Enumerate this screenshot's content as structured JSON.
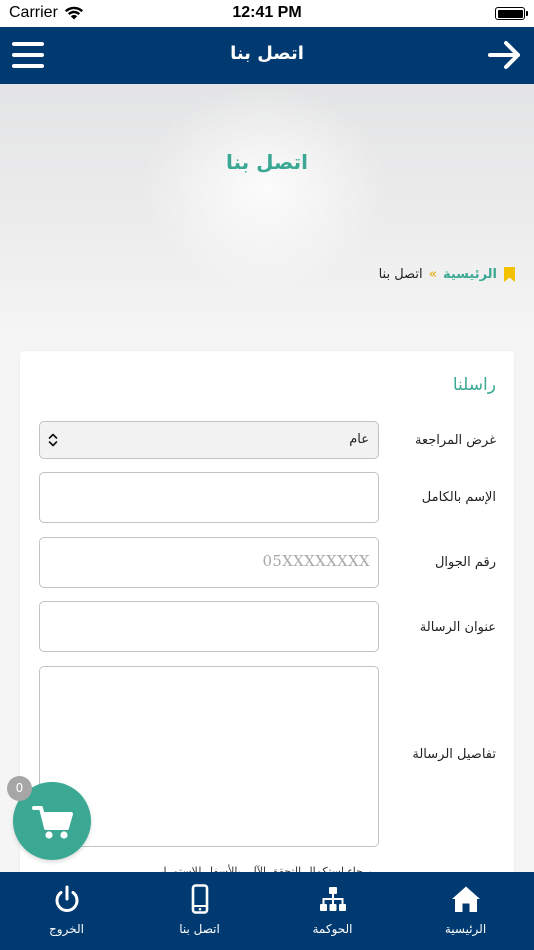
{
  "status_bar": {
    "carrier": "Carrier",
    "time": "12:41 PM"
  },
  "navbar": {
    "title": "اتصل بنا"
  },
  "hero": {
    "title": "اتصل بنا"
  },
  "breadcrumb": {
    "home": "الرئيسية",
    "separator": "»",
    "current": "اتصل بنا"
  },
  "form": {
    "title": "راسلنا",
    "purpose": {
      "label": "غرض المراجعة",
      "value": "عام"
    },
    "full_name": {
      "label": "الإسم بالكامل",
      "value": ""
    },
    "mobile": {
      "label": "رقم الجوال",
      "placeholder": "05XXXXXXXX"
    },
    "subject": {
      "label": "عنوان الرسالة",
      "value": ""
    },
    "details": {
      "label": "تفاصيل الرسالة",
      "value": ""
    },
    "captcha_note": "برجاء استكمال التحقق الآلي بالأسفل للاستمرار"
  },
  "cart": {
    "count": "0"
  },
  "tabbar": {
    "items": [
      {
        "label": "الرئيسية",
        "icon": "home-icon"
      },
      {
        "label": "الحوكمة",
        "icon": "org-chart-icon"
      },
      {
        "label": "اتصل بنا",
        "icon": "mobile-phone-icon"
      },
      {
        "label": "الخروج",
        "icon": "power-icon"
      }
    ]
  },
  "colors": {
    "primary": "#003a70",
    "accent": "#3aa893",
    "separator": "#e8b62c",
    "badge": "#a6a6a6"
  }
}
